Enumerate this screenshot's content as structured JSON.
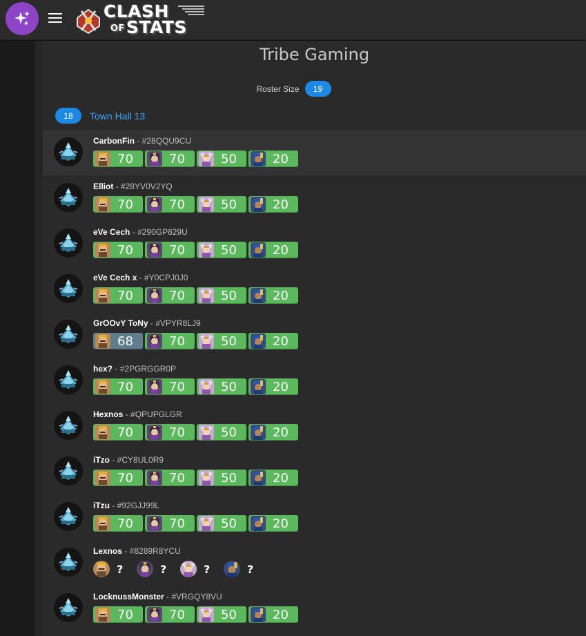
{
  "app": {
    "logo_line1": "CLASH",
    "logo_of": "OF",
    "logo_line2": "STATS"
  },
  "clan": {
    "name": "Tribe Gaming"
  },
  "roster": {
    "label": "Roster Size",
    "size": "19"
  },
  "town_hall_group": {
    "count": "18",
    "label": "Town Hall 13"
  },
  "hero_icons": [
    "barbarian-king-icon",
    "archer-queen-icon",
    "grand-warden-icon",
    "royal-champion-icon"
  ],
  "colors": {
    "maxed": "#5cb85c",
    "not_maxed": "#607d8b",
    "accent": "#1e88e5",
    "fab": "#8e44c6"
  },
  "players": [
    {
      "name": "CarbonFin",
      "tag": "#28QQU9CU",
      "heroes": [
        "70",
        "70",
        "50",
        "20"
      ]
    },
    {
      "name": "Elliot",
      "tag": "#28YV0V2YQ",
      "heroes": [
        "70",
        "70",
        "50",
        "20"
      ]
    },
    {
      "name": "eVe Cech",
      "tag": "#290GP829U",
      "heroes": [
        "70",
        "70",
        "50",
        "20"
      ]
    },
    {
      "name": "eVe Cech x",
      "tag": "#Y0CPJ0J0",
      "heroes": [
        "70",
        "70",
        "50",
        "20"
      ]
    },
    {
      "name": "GrOOvY ToNy",
      "tag": "#VPYR8LJ9",
      "heroes": [
        "68",
        "70",
        "50",
        "20"
      ]
    },
    {
      "name": "hex?",
      "tag": "#2PGRGGR0P",
      "heroes": [
        "70",
        "70",
        "50",
        "20"
      ]
    },
    {
      "name": "Hexnos",
      "tag": "#QPUPGLGR",
      "heroes": [
        "70",
        "70",
        "50",
        "20"
      ]
    },
    {
      "name": "iTzo",
      "tag": "#CY8UL0R9",
      "heroes": [
        "70",
        "70",
        "50",
        "20"
      ]
    },
    {
      "name": "iTzu",
      "tag": "#92GJJ99L",
      "heroes": [
        "70",
        "70",
        "50",
        "20"
      ]
    },
    {
      "name": "Lexnos",
      "tag": "#8289R8YCU",
      "heroes": [
        "?",
        "?",
        "?",
        "?"
      ]
    },
    {
      "name": "LocknussMonster",
      "tag": "#VRGQY8VU",
      "heroes": [
        "70",
        "70",
        "50",
        "20"
      ]
    }
  ]
}
